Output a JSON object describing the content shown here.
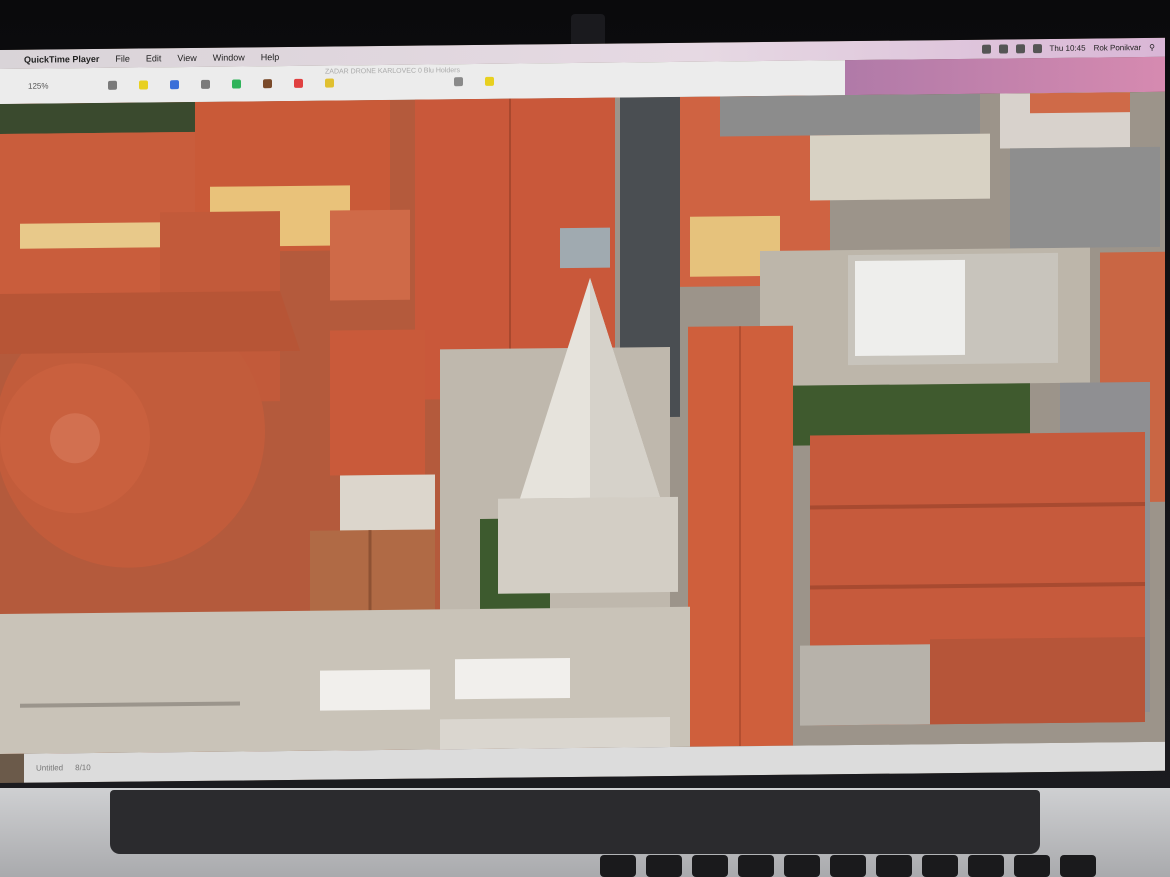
{
  "menubar": {
    "apple_glyph": "",
    "app_name": "QuickTime Player",
    "items": [
      "File",
      "Edit",
      "View",
      "Window",
      "Help"
    ],
    "clock": "Thu 10:45",
    "user": "Rok Ponikvar"
  },
  "toolbar": {
    "zoom": "125%",
    "window_title": "ZADAR DRONE KARLOVEC 0 Blu Holders"
  },
  "statusbar": {
    "left": "Untitled",
    "right": "8/10"
  },
  "colors": {
    "roof": "#c8593a",
    "tower": "#e6e3dc",
    "plaza": "#c9c3b8"
  }
}
